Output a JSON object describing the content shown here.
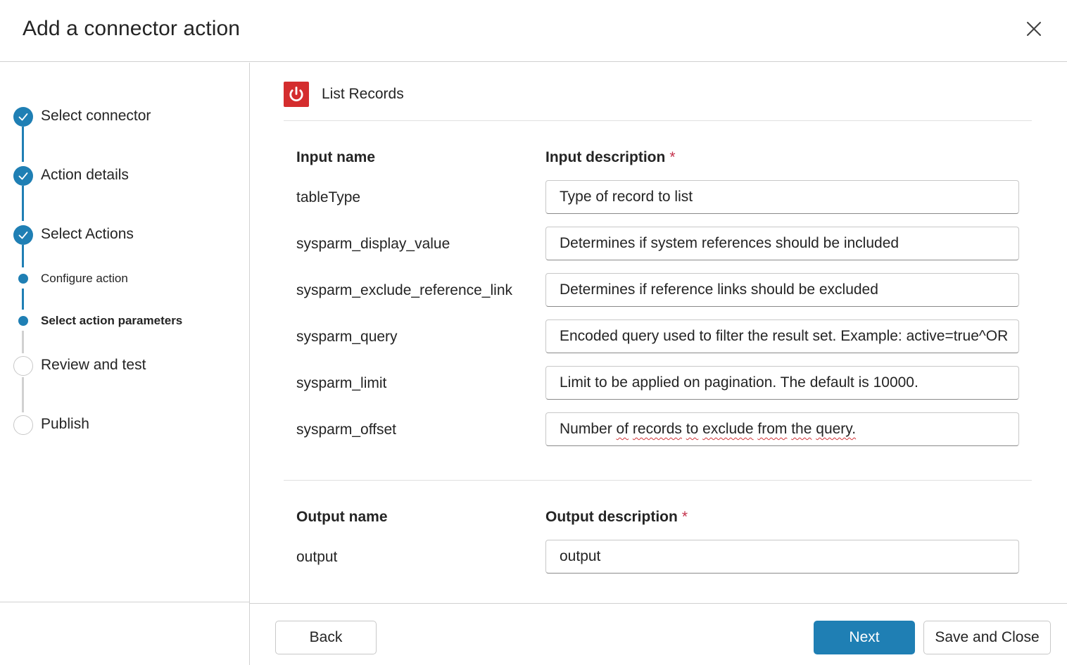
{
  "dialog": {
    "title": "Add a connector action",
    "close_icon": "close-icon"
  },
  "stepper": {
    "accent_color": "#1f7fb4",
    "steps": [
      {
        "label": "Select connector",
        "status": "completed"
      },
      {
        "label": "Action details",
        "status": "completed"
      },
      {
        "label": "Select Actions",
        "status": "completed"
      },
      {
        "label": "Configure action",
        "status": "current-substep"
      },
      {
        "label": "Select action parameters",
        "status": "active-substep"
      },
      {
        "label": "Review and test",
        "status": "pending"
      },
      {
        "label": "Publish",
        "status": "pending"
      }
    ]
  },
  "action": {
    "name": "List Records",
    "icon": "power-icon",
    "icon_color": "#d42d2e"
  },
  "inputs": {
    "name_header": "Input name",
    "description_header": "Input description",
    "required_marker": "*",
    "rows": [
      {
        "name": "tableType",
        "description": "Type of record to list"
      },
      {
        "name": "sysparm_display_value",
        "description": "Determines if system references should be included"
      },
      {
        "name": "sysparm_exclude_reference_link",
        "description": "Determines if reference links should be excluded"
      },
      {
        "name": "sysparm_query",
        "description": "Encoded query used to filter the result set. Example: active=true^OR"
      },
      {
        "name": "sysparm_limit",
        "description": "Limit to be applied on pagination. The default is 10000."
      },
      {
        "name": "sysparm_offset",
        "description": "Number of records to exclude from the query."
      }
    ]
  },
  "outputs": {
    "name_header": "Output name",
    "description_header": "Output description",
    "required_marker": "*",
    "rows": [
      {
        "name": "output",
        "description": "output"
      }
    ]
  },
  "footer": {
    "back_label": "Back",
    "next_label": "Next",
    "save_close_label": "Save and Close"
  }
}
